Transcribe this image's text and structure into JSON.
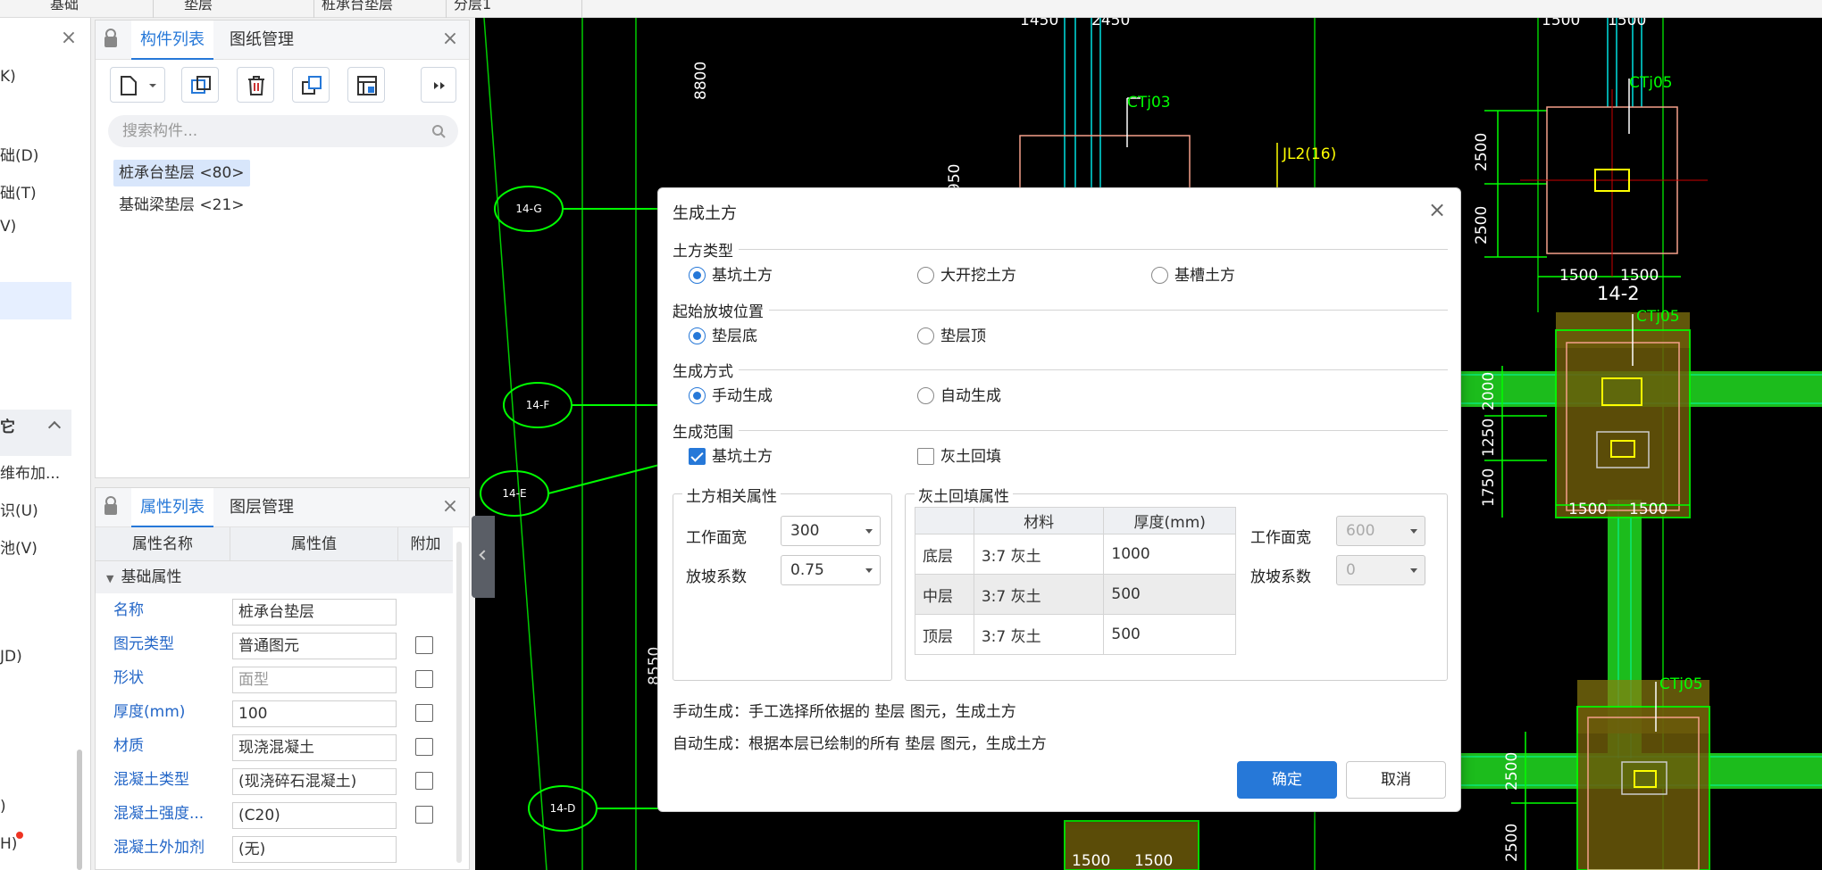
{
  "top_strip": [
    "基础",
    "垫层",
    "桩承台垫层",
    "分层1"
  ],
  "left_panel": {
    "items": [
      "K)",
      "础(D)",
      "础(T)",
      "V)",
      "它",
      "维布加...",
      "识(U)",
      "池(V)",
      "JD)",
      ")",
      "H)"
    ]
  },
  "component_panel": {
    "tabs": [
      "构件列表",
      "图纸管理"
    ],
    "search_placeholder": "搜索构件...",
    "items": [
      "桩承台垫层 <80>",
      "基础梁垫层 <21>"
    ]
  },
  "property_panel": {
    "tabs": [
      "属性列表",
      "图层管理"
    ],
    "columns": [
      "属性名称",
      "属性值",
      "附加"
    ],
    "group": "基础属性",
    "rows": [
      {
        "name": "名称",
        "value": "桩承台垫层"
      },
      {
        "name": "图元类型",
        "value": "普通图元"
      },
      {
        "name": "形状",
        "value": "面型"
      },
      {
        "name": "厚度(mm)",
        "value": "100"
      },
      {
        "name": "材质",
        "value": "现浇混凝土"
      },
      {
        "name": "混凝土类型",
        "value": "(现浇碎石混凝土)"
      },
      {
        "name": "混凝土强度...",
        "value": "(C20)"
      },
      {
        "name": "混凝土外加剂",
        "value": "(无)"
      }
    ]
  },
  "cad": {
    "labels": [
      "14-G",
      "14-F",
      "14-E",
      "14-D",
      "14-2",
      "CTj03",
      "CTj05",
      "CTj05",
      "CTj05",
      "JL2(16)",
      "8800",
      "950",
      "8550",
      "2500",
      "2500",
      "2000",
      "1250",
      "1750",
      "2500",
      "2500",
      "1500",
      "1500",
      "1500",
      "1500",
      "1500",
      "1500",
      "1500",
      "1500",
      "1450",
      "2450",
      "1500",
      "1500"
    ]
  },
  "dialog": {
    "title": "生成土方",
    "sections": {
      "type": {
        "label": "土方类型",
        "options": [
          "基坑土方",
          "大开挖土方",
          "基槽土方"
        ],
        "selected": 0
      },
      "start": {
        "label": "起始放坡位置",
        "options": [
          "垫层底",
          "垫层顶"
        ],
        "selected": 0
      },
      "method": {
        "label": "生成方式",
        "options": [
          "手动生成",
          "自动生成"
        ],
        "selected": 0
      },
      "range": {
        "label": "生成范围",
        "options": [
          "基坑土方",
          "灰土回填"
        ],
        "checked": [
          true,
          false
        ]
      }
    },
    "earth": {
      "title": "土方相关属性",
      "work_width_label": "工作面宽",
      "work_width": "300",
      "slope_label": "放坡系数",
      "slope": "0.75"
    },
    "backfill": {
      "title": "灰土回填属性",
      "columns": [
        "材料",
        "厚度(mm)"
      ],
      "rows": [
        {
          "layer": "底层",
          "material": "3:7 灰土",
          "thickness": "1000"
        },
        {
          "layer": "中层",
          "material": "3:7 灰土",
          "thickness": "500"
        },
        {
          "layer": "顶层",
          "material": "3:7 灰土",
          "thickness": "500"
        }
      ],
      "work_width_label": "工作面宽",
      "work_width": "600",
      "slope_label": "放坡系数",
      "slope": "0"
    },
    "notes": [
      "手动生成：手工选择所依据的 垫层 图元，生成土方",
      "自动生成：根据本层已绘制的所有 垫层 图元，生成土方"
    ],
    "ok_label": "确定",
    "cancel_label": "取消"
  },
  "colors": {
    "accent": "#2678d8",
    "cad_bg": "#000000",
    "cad_green": "#00ff00",
    "cad_cyan": "#00e0e0"
  }
}
